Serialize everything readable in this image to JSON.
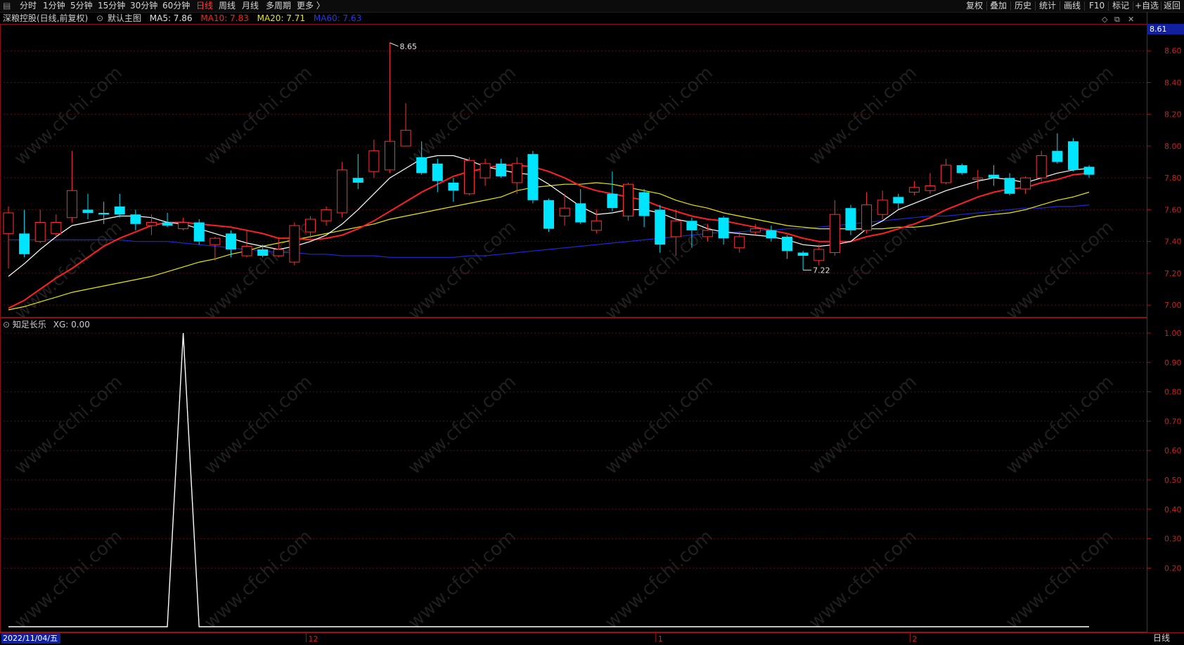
{
  "toolbar": {
    "left_items": [
      "分时",
      "1分钟",
      "5分钟",
      "15分钟",
      "30分钟",
      "60分钟",
      "日线",
      "周线",
      "月线",
      "多周期",
      "更多 〉"
    ],
    "active": "日线",
    "right_items": [
      "复权",
      "叠加",
      "历史",
      "统计",
      "画线",
      "F10",
      "标记",
      "+自选",
      "返回"
    ]
  },
  "header": {
    "stock": "深粮控股(日线,前复权)",
    "template": "默认主图",
    "ma5": "MA5: 7.86",
    "ma10": "MA10: 7.83",
    "ma20": "MA20: 7.71",
    "ma60": "MA60: 7.63"
  },
  "sub_header": {
    "indicator": "知足长乐",
    "xg": "XG: 0.00"
  },
  "price_tag": "8.61",
  "date_tag": "2022/11/04/五",
  "bottom_right": "日线",
  "x_axis_labels": [
    "12",
    "1",
    "2"
  ],
  "high_label": "8.65",
  "low_label": "7.22",
  "watermark": "www.cfchi.com",
  "colors": {
    "up": "#ff3030",
    "down": "#00e5ff",
    "ma5": "#ffffff",
    "ma10": "#ff2020",
    "ma20": "#e8e800",
    "ma60": "#1a2ad8",
    "axis": "#cc2020"
  },
  "chart_data": [
    {
      "type": "candlestick",
      "y_ticks": [
        7.0,
        7.2,
        7.4,
        7.6,
        7.8,
        8.0,
        8.2,
        8.4,
        8.6
      ],
      "ylim": [
        6.93,
        8.76
      ],
      "candles": [
        [
          7.45,
          7.58,
          7.62,
          7.23
        ],
        [
          7.45,
          7.32,
          7.6,
          7.3
        ],
        [
          7.4,
          7.52,
          7.6,
          7.39
        ],
        [
          7.45,
          7.52,
          7.57,
          7.42
        ],
        [
          7.55,
          7.72,
          7.97,
          7.52
        ],
        [
          7.6,
          7.58,
          7.7,
          7.54
        ],
        [
          7.58,
          7.57,
          7.65,
          7.51
        ],
        [
          7.62,
          7.57,
          7.7,
          7.55
        ],
        [
          7.57,
          7.51,
          7.6,
          7.47
        ],
        [
          7.5,
          7.52,
          7.57,
          7.44
        ],
        [
          7.52,
          7.5,
          7.58,
          7.49
        ],
        [
          7.48,
          7.52,
          7.55,
          7.47
        ],
        [
          7.52,
          7.4,
          7.54,
          7.38
        ],
        [
          7.38,
          7.42,
          7.43,
          7.28
        ],
        [
          7.45,
          7.35,
          7.47,
          7.3
        ],
        [
          7.31,
          7.37,
          7.47,
          7.3
        ],
        [
          7.35,
          7.31,
          7.38,
          7.3
        ],
        [
          7.31,
          7.35,
          7.42,
          7.3
        ],
        [
          7.27,
          7.5,
          7.52,
          7.25
        ],
        [
          7.46,
          7.54,
          7.56,
          7.42
        ],
        [
          7.53,
          7.6,
          7.62,
          7.5
        ],
        [
          7.58,
          7.85,
          7.9,
          7.55
        ],
        [
          7.8,
          7.77,
          7.95,
          7.73
        ],
        [
          7.84,
          7.97,
          8.04,
          7.8
        ],
        [
          7.85,
          8.03,
          8.65,
          7.83
        ],
        [
          8.0,
          8.1,
          8.27,
          8.0
        ],
        [
          7.93,
          7.83,
          8.03,
          7.82
        ],
        [
          7.89,
          7.78,
          7.92,
          7.71
        ],
        [
          7.77,
          7.72,
          7.8,
          7.65
        ],
        [
          7.7,
          7.91,
          7.93,
          7.69
        ],
        [
          7.8,
          7.89,
          7.92,
          7.75
        ],
        [
          7.89,
          7.81,
          7.92,
          7.8
        ],
        [
          7.77,
          7.89,
          7.93,
          7.7
        ],
        [
          7.95,
          7.66,
          7.97,
          7.64
        ],
        [
          7.66,
          7.48,
          7.67,
          7.46
        ],
        [
          7.56,
          7.61,
          7.7,
          7.5
        ],
        [
          7.64,
          7.52,
          7.73,
          7.51
        ],
        [
          7.47,
          7.53,
          7.6,
          7.45
        ],
        [
          7.7,
          7.61,
          7.84,
          7.59
        ],
        [
          7.56,
          7.76,
          7.77,
          7.53
        ],
        [
          7.71,
          7.56,
          7.73,
          7.49
        ],
        [
          7.6,
          7.38,
          7.63,
          7.33
        ],
        [
          7.43,
          7.53,
          7.6,
          7.31
        ],
        [
          7.53,
          7.47,
          7.55,
          7.36
        ],
        [
          7.43,
          7.47,
          7.51,
          7.4
        ],
        [
          7.55,
          7.42,
          7.56,
          7.38
        ],
        [
          7.36,
          7.43,
          7.46,
          7.33
        ],
        [
          7.46,
          7.48,
          7.51,
          7.44
        ],
        [
          7.47,
          7.42,
          7.5,
          7.4
        ],
        [
          7.43,
          7.34,
          7.44,
          7.29
        ],
        [
          7.33,
          7.31,
          7.34,
          7.22
        ],
        [
          7.28,
          7.35,
          7.38,
          7.25
        ],
        [
          7.33,
          7.57,
          7.66,
          7.31
        ],
        [
          7.61,
          7.47,
          7.63,
          7.44
        ],
        [
          7.47,
          7.63,
          7.71,
          7.45
        ],
        [
          7.57,
          7.66,
          7.72,
          7.54
        ],
        [
          7.68,
          7.64,
          7.7,
          7.6
        ],
        [
          7.71,
          7.74,
          7.78,
          7.69
        ],
        [
          7.72,
          7.75,
          7.83,
          7.7
        ],
        [
          7.77,
          7.88,
          7.92,
          7.76
        ],
        [
          7.88,
          7.83,
          7.89,
          7.82
        ],
        [
          7.79,
          7.8,
          7.85,
          7.73
        ],
        [
          7.82,
          7.8,
          7.88,
          7.75
        ],
        [
          7.8,
          7.7,
          7.83,
          7.69
        ],
        [
          7.73,
          7.8,
          7.81,
          7.7
        ],
        [
          7.8,
          7.94,
          7.97,
          7.78
        ],
        [
          7.97,
          7.9,
          8.08,
          7.89
        ],
        [
          8.03,
          7.85,
          8.05,
          7.84
        ],
        [
          7.87,
          7.82,
          7.88,
          7.8
        ]
      ],
      "ma5": [
        7.18,
        7.26,
        7.35,
        7.43,
        7.5,
        7.52,
        7.54,
        7.56,
        7.56,
        7.55,
        7.52,
        7.51,
        7.48,
        7.45,
        7.42,
        7.39,
        7.37,
        7.35,
        7.37,
        7.4,
        7.44,
        7.51,
        7.6,
        7.7,
        7.8,
        7.86,
        7.92,
        7.94,
        7.94,
        7.91,
        7.87,
        7.85,
        7.83,
        7.82,
        7.76,
        7.69,
        7.62,
        7.57,
        7.58,
        7.6,
        7.6,
        7.58,
        7.54,
        7.52,
        7.48,
        7.46,
        7.45,
        7.44,
        7.43,
        7.41,
        7.38,
        7.37,
        7.38,
        7.4,
        7.48,
        7.53,
        7.6,
        7.64,
        7.68,
        7.72,
        7.75,
        7.78,
        7.8,
        7.79,
        7.77,
        7.8,
        7.83,
        7.85,
        7.86
      ],
      "ma10": [
        6.98,
        7.03,
        7.1,
        7.17,
        7.23,
        7.3,
        7.37,
        7.42,
        7.46,
        7.5,
        7.52,
        7.52,
        7.51,
        7.5,
        7.49,
        7.47,
        7.45,
        7.42,
        7.42,
        7.41,
        7.42,
        7.44,
        7.48,
        7.53,
        7.59,
        7.65,
        7.71,
        7.76,
        7.81,
        7.84,
        7.86,
        7.88,
        7.88,
        7.87,
        7.84,
        7.8,
        7.75,
        7.72,
        7.7,
        7.68,
        7.66,
        7.62,
        7.59,
        7.56,
        7.54,
        7.53,
        7.51,
        7.49,
        7.47,
        7.45,
        7.42,
        7.4,
        7.4,
        7.4,
        7.43,
        7.45,
        7.48,
        7.51,
        7.55,
        7.6,
        7.64,
        7.68,
        7.71,
        7.73,
        7.74,
        7.77,
        7.79,
        7.82,
        7.83
      ],
      "ma20": [
        6.97,
        6.99,
        7.02,
        7.05,
        7.08,
        7.1,
        7.12,
        7.14,
        7.16,
        7.18,
        7.21,
        7.24,
        7.27,
        7.29,
        7.32,
        7.34,
        7.37,
        7.39,
        7.41,
        7.43,
        7.45,
        7.47,
        7.49,
        7.51,
        7.54,
        7.56,
        7.58,
        7.6,
        7.62,
        7.64,
        7.66,
        7.68,
        7.72,
        7.74,
        7.75,
        7.76,
        7.76,
        7.77,
        7.76,
        7.74,
        7.72,
        7.7,
        7.66,
        7.63,
        7.61,
        7.58,
        7.56,
        7.54,
        7.52,
        7.5,
        7.49,
        7.48,
        7.48,
        7.48,
        7.48,
        7.48,
        7.49,
        7.49,
        7.5,
        7.52,
        7.54,
        7.56,
        7.57,
        7.58,
        7.6,
        7.63,
        7.66,
        7.68,
        7.71
      ],
      "ma60": [
        7.41,
        7.41,
        7.41,
        7.41,
        7.41,
        7.41,
        7.41,
        7.41,
        7.4,
        7.4,
        7.4,
        7.39,
        7.38,
        7.37,
        7.36,
        7.35,
        7.34,
        7.33,
        7.33,
        7.32,
        7.32,
        7.31,
        7.31,
        7.31,
        7.3,
        7.3,
        7.3,
        7.3,
        7.3,
        7.31,
        7.31,
        7.32,
        7.33,
        7.34,
        7.35,
        7.36,
        7.37,
        7.38,
        7.39,
        7.4,
        7.41,
        7.42,
        7.43,
        7.44,
        7.45,
        7.46,
        7.46,
        7.47,
        7.47,
        7.48,
        7.48,
        7.49,
        7.5,
        7.51,
        7.52,
        7.53,
        7.54,
        7.55,
        7.56,
        7.56,
        7.57,
        7.58,
        7.59,
        7.6,
        7.61,
        7.61,
        7.62,
        7.62,
        7.63
      ]
    },
    {
      "type": "line",
      "title": "知足长乐",
      "y_ticks": [
        0.2,
        0.3,
        0.4,
        0.5,
        0.6,
        0.7,
        0.8,
        0.9,
        1.0
      ],
      "ylim": [
        0,
        1.0
      ],
      "values": [
        0,
        0,
        0,
        0,
        0,
        0,
        0,
        0,
        0,
        0,
        0,
        1,
        0,
        0,
        0,
        0,
        0,
        0,
        0,
        0,
        0,
        0,
        0,
        0,
        0,
        0,
        0,
        0,
        0,
        0,
        0,
        0,
        0,
        0,
        0,
        0,
        0,
        0,
        0,
        0,
        0,
        0,
        0,
        0,
        0,
        0,
        0,
        0,
        0,
        0,
        0,
        0,
        0,
        0,
        0,
        0,
        0,
        0,
        0,
        0,
        0,
        0,
        0,
        0,
        0,
        0,
        0,
        0,
        0
      ]
    }
  ]
}
